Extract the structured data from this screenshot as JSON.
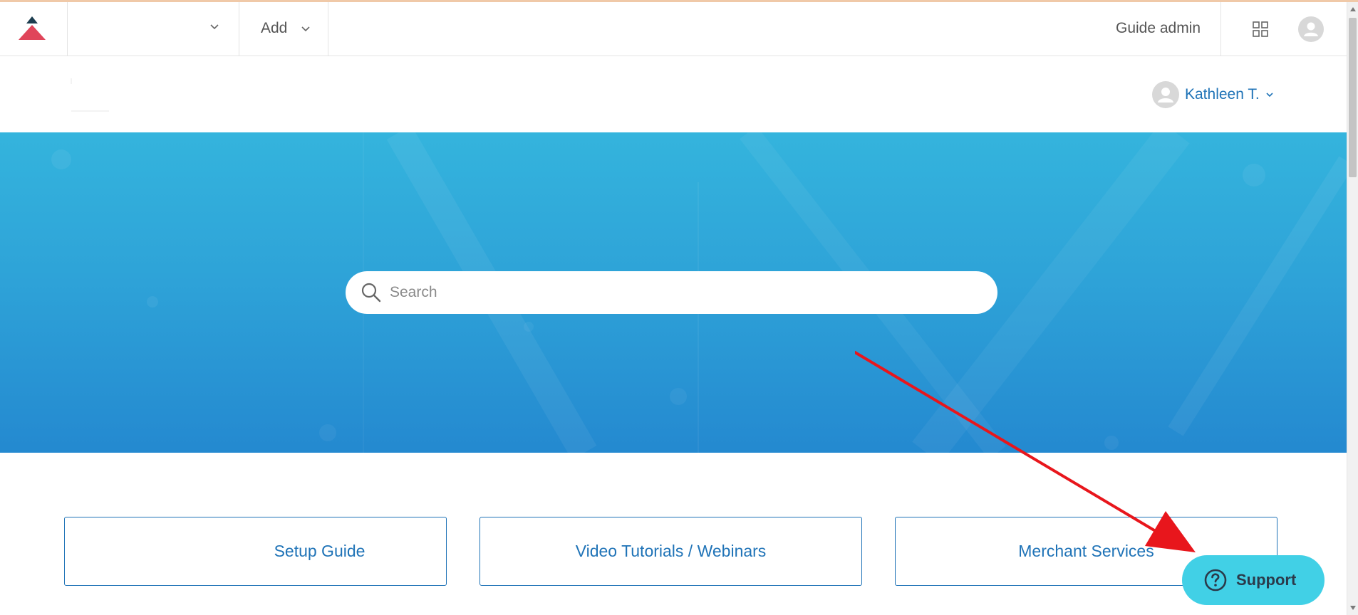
{
  "topbar": {
    "add_label": "Add",
    "guide_admin_label": "Guide admin"
  },
  "header": {
    "user_name": "Kathleen T."
  },
  "hero": {
    "search_placeholder": "Search"
  },
  "categories": [
    {
      "label": "Setup Guide"
    },
    {
      "label": "Video Tutorials / Webinars"
    },
    {
      "label": "Merchant Services"
    }
  ],
  "support_widget": {
    "label": "Support"
  },
  "colors": {
    "link_blue": "#1f73b7",
    "hero_top": "#34b4dd",
    "hero_bottom": "#2489d0",
    "support_bg": "#41d0e6",
    "logo_red": "#e0455a",
    "logo_dark": "#1c3d4f",
    "annotation_red": "#e8161c"
  },
  "icons": {
    "logo": "triangle-logo-icon",
    "brand_dropdown": "chevron-down-icon",
    "apps": "grid-apps-icon",
    "user": "user-avatar-icon",
    "search": "search-icon",
    "support": "question-circle-icon"
  }
}
